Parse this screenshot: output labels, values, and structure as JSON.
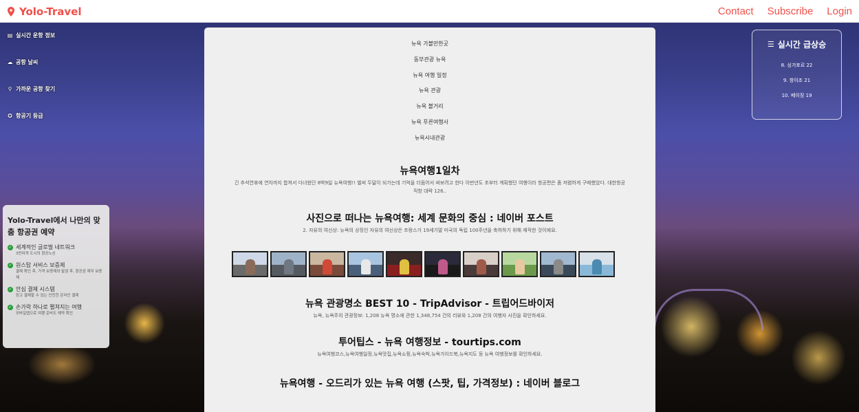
{
  "header": {
    "brand": "Yolo-Travel",
    "nav": [
      "Contact",
      "Subscribe",
      "Login"
    ]
  },
  "sidebar": {
    "items": [
      {
        "icon": "table-icon",
        "glyph": "▤",
        "label": "실시간 운항 정보"
      },
      {
        "icon": "cloud-icon",
        "glyph": "☁",
        "label": "공항 날씨"
      },
      {
        "icon": "search-icon",
        "glyph": "⚲",
        "label": "가까운 공항 찾기"
      },
      {
        "icon": "star-icon",
        "glyph": "✪",
        "label": "항공기 등급"
      }
    ]
  },
  "promo": {
    "title": "Yolo-Travel에서 나만의 맞춤 항공권 예약",
    "features": [
      {
        "label": "세계적인 글로벌 네트워크",
        "desc": "3만여개 도시의 항공노선"
      },
      {
        "label": "원스탑 서비스 보증제",
        "desc": "결제 확인 후, 가격 보증제와 발권 후, 항공권 재무 보증제"
      },
      {
        "label": "안심 결제 시스템",
        "desc": "믿고 결제할 수 있는 안전한 온라인 결제"
      },
      {
        "label": "손가락 하나로 펼쳐지는 여행",
        "desc": "모바일앱으로 여행 준비도 예약 확인"
      }
    ]
  },
  "main": {
    "categories": [
      "뉴욕 가볼만한곳",
      "동부관광 뉴욕",
      "뉴욕 여행 일정",
      "뉴욕 관광",
      "뉴욕 볼거리",
      "뉴욕 푸른여행사",
      "뉴욕시내관광"
    ],
    "results": [
      {
        "title": "뉴욕여행1일차",
        "desc": "긴 추석연휴에 연차까지 합쳐서 다녀왔던 8박9일 뉴욕여행!! 벌써 두달이 되가는데 기억을 더듬어서 써보려고 한다 이번년도 초부터 계획했던 여행이라 항공편은 좀 저렴하게 구매했었다. 대한항공 직항 대략 126.."
      },
      {
        "title": "사진으로 떠나는 뉴욕여행: 세계 문화의 중심 : 네이버 포스트",
        "desc": "2. 자유의 여신상: 뉴욕의 상징인 자유의 여신상은 프랑스가 19세기말 미국의 독립 100주년을 축하하기 위해 제작한 것이에요."
      },
      {
        "title": "뉴욕 관광명소 BEST 10 - TripAdvisor - 트립어드바이저",
        "desc": "뉴욕, 뉴욕주의 관광정보: 1,208 뉴욕 명소에 관한 1,348,754 건의 리뷰와 1,208 건의 여행자 사진을 확인하세요."
      },
      {
        "title": "투어팁스 - 뉴욕 여행정보 - tourtips.com",
        "desc": "뉴욕여행코스,뉴욕여행일정,뉴욕맛집,뉴욕쇼핑,뉴욕숙박,뉴욕가이드북,뉴욕지도 등 뉴욕 여행정보를 확인하세요."
      },
      {
        "title": "뉴욕여행 - 오드리가 있는 뉴욕 여행 (스팟, 팁, 가격정보) : 네이버 블로그",
        "desc": ""
      }
    ],
    "thumbnails": [
      {
        "sky": "#cfd8e6",
        "ground": "#6a6a6a",
        "fig": "#8a6b5a"
      },
      {
        "sky": "#9fb3c8",
        "ground": "#555a60",
        "fig": "#6f7782"
      },
      {
        "sky": "#c9b7a0",
        "ground": "#7a4a3a",
        "fig": "#d04a3a"
      },
      {
        "sky": "#a8c4e0",
        "ground": "#4a5f7a",
        "fig": "#e8e8e8"
      },
      {
        "sky": "#3a2a2a",
        "ground": "#8a1f1f",
        "fig": "#e0c040"
      },
      {
        "sky": "#2a2a3a",
        "ground": "#1a1a1a",
        "fig": "#c05a8a"
      },
      {
        "sky": "#d8d0c8",
        "ground": "#4a3a3a",
        "fig": "#a05a4a"
      },
      {
        "sky": "#b8d8a0",
        "ground": "#6a9a4a",
        "fig": "#e8c8a0"
      },
      {
        "sky": "#a0b8d0",
        "ground": "#3a4a5a",
        "fig": "#8a8a8a"
      },
      {
        "sky": "#d8e0e8",
        "ground": "#8ab8d8",
        "fig": "#4a8ab0"
      }
    ]
  },
  "trending": {
    "title": "실시간 급상승",
    "icon": "list-icon",
    "items": [
      "8. 싱가포르 22",
      "9. 창이조 21",
      "10. 베이징 19"
    ]
  },
  "colors": {
    "accent": "#f0504a",
    "check": "#2a9d3a"
  }
}
